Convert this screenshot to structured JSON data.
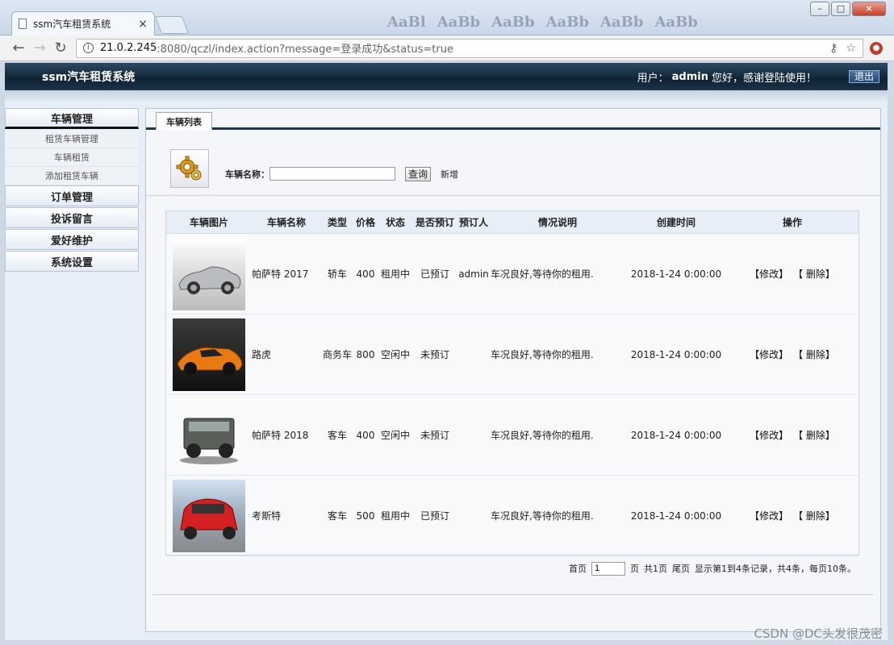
{
  "browser": {
    "tab_title": "ssm汽车租赁系统",
    "tab_close": "×",
    "url_host": "21.0.2.245",
    "url_rest": ":8080/qczl/index.action?message=登录成功&status=true",
    "window_buttons": {
      "minimize": "–",
      "maximize": "□",
      "close": "×"
    }
  },
  "header": {
    "title": "ssm汽车租赁系统",
    "user_prefix": "用户：",
    "username": "admin",
    "greeting": "您好，感谢登陆使用！",
    "logout": "退出"
  },
  "sidebar": {
    "groups": [
      {
        "label": "车辆管理",
        "items": [
          "租赁车辆管理",
          "车辆租赁",
          "添加租赁车辆"
        ]
      },
      {
        "label": "订单管理"
      },
      {
        "label": "投诉留言"
      },
      {
        "label": "爱好维护"
      },
      {
        "label": "系统设置"
      }
    ]
  },
  "main": {
    "tab": "车辆列表",
    "search_label": "车辆名称：",
    "search_value": "",
    "query_button": "查询",
    "add_link": "新增"
  },
  "table": {
    "headers": [
      "车辆图片",
      "车辆名称",
      "类型",
      "价格",
      "状态",
      "是否预订",
      "预订人",
      "情况说明",
      "创建时间",
      "操作"
    ],
    "rows": [
      {
        "name": "帕萨特 2017",
        "type": "轿车",
        "price": "400",
        "status": "租用中",
        "booked": "已预订",
        "booker": "admin",
        "desc": "车况良好,等待你的租用.",
        "time": "2018-1-24 0:00:00",
        "img": "silver-convertible"
      },
      {
        "name": "路虎",
        "type": "商务车",
        "price": "800",
        "status": "空闲中",
        "booked": "未预订",
        "booker": "",
        "desc": "车况良好,等待你的租用.",
        "time": "2018-1-24 0:00:00",
        "img": "orange-sportscar"
      },
      {
        "name": "帕萨特 2018",
        "type": "客车",
        "price": "400",
        "status": "空闲中",
        "booked": "未预订",
        "booker": "",
        "desc": "车况良好,等待你的租用.",
        "time": "2018-1-24 0:00:00",
        "img": "gray-suv"
      },
      {
        "name": "考斯特",
        "type": "客车",
        "price": "500",
        "status": "租用中",
        "booked": "已预订",
        "booker": "",
        "desc": "车况良好,等待你的租用.",
        "time": "2018-1-24 0:00:00",
        "img": "red-hatchback"
      }
    ],
    "edit_label": "【修改】",
    "delete_label": "【 删除】"
  },
  "pager": {
    "first": "首页",
    "page_value": "1",
    "page_suffix": "页",
    "total_pages": "共1页",
    "last": "尾页",
    "summary": "显示第1到4条记录，共4条，每页10条。"
  },
  "watermark": "CSDN @DC头发很茂密",
  "colors": {
    "header_bg": "#0f2233",
    "accent": "#1b3654"
  }
}
